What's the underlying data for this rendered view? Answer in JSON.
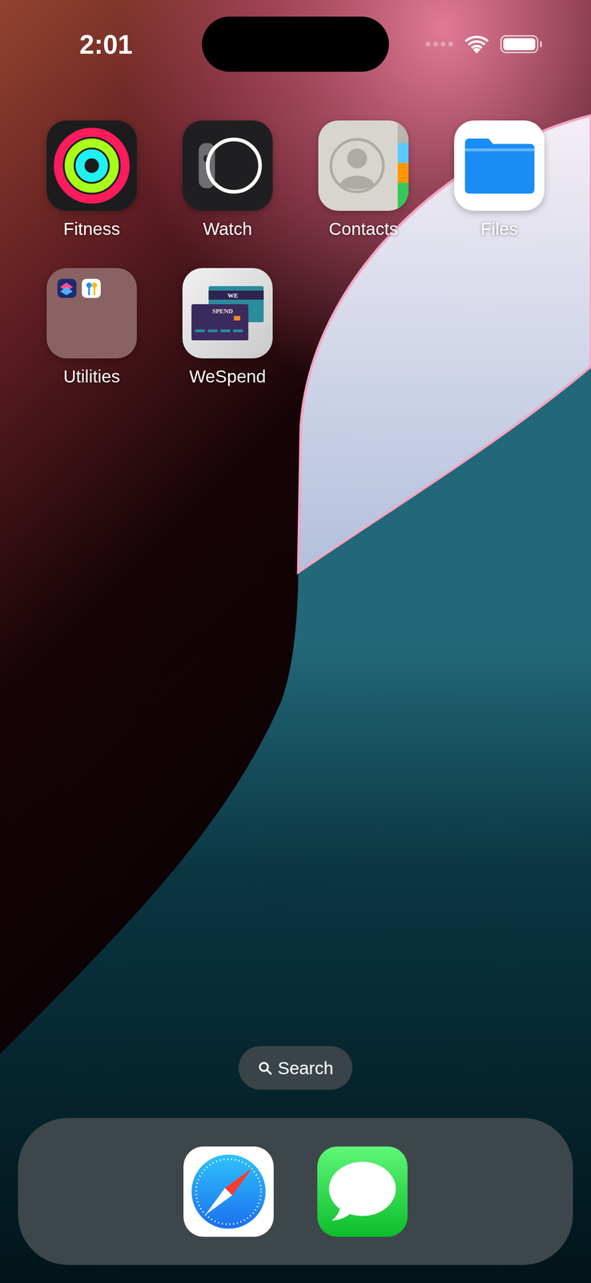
{
  "status_bar": {
    "time": "2:01",
    "signal": 0,
    "wifi": true,
    "battery": 1
  },
  "apps": [
    {
      "label": "Fitness",
      "kind": "fitness"
    },
    {
      "label": "Watch",
      "kind": "watch"
    },
    {
      "label": "Contacts",
      "kind": "contacts"
    },
    {
      "label": "Files",
      "kind": "files"
    },
    {
      "label": "Utilities",
      "kind": "folder"
    },
    {
      "label": "WeSpend",
      "kind": "wespend",
      "card_texts": [
        "WE",
        "SPEND"
      ]
    }
  ],
  "search": {
    "label": "Search"
  },
  "dock": [
    {
      "kind": "safari"
    },
    {
      "kind": "messages"
    }
  ]
}
